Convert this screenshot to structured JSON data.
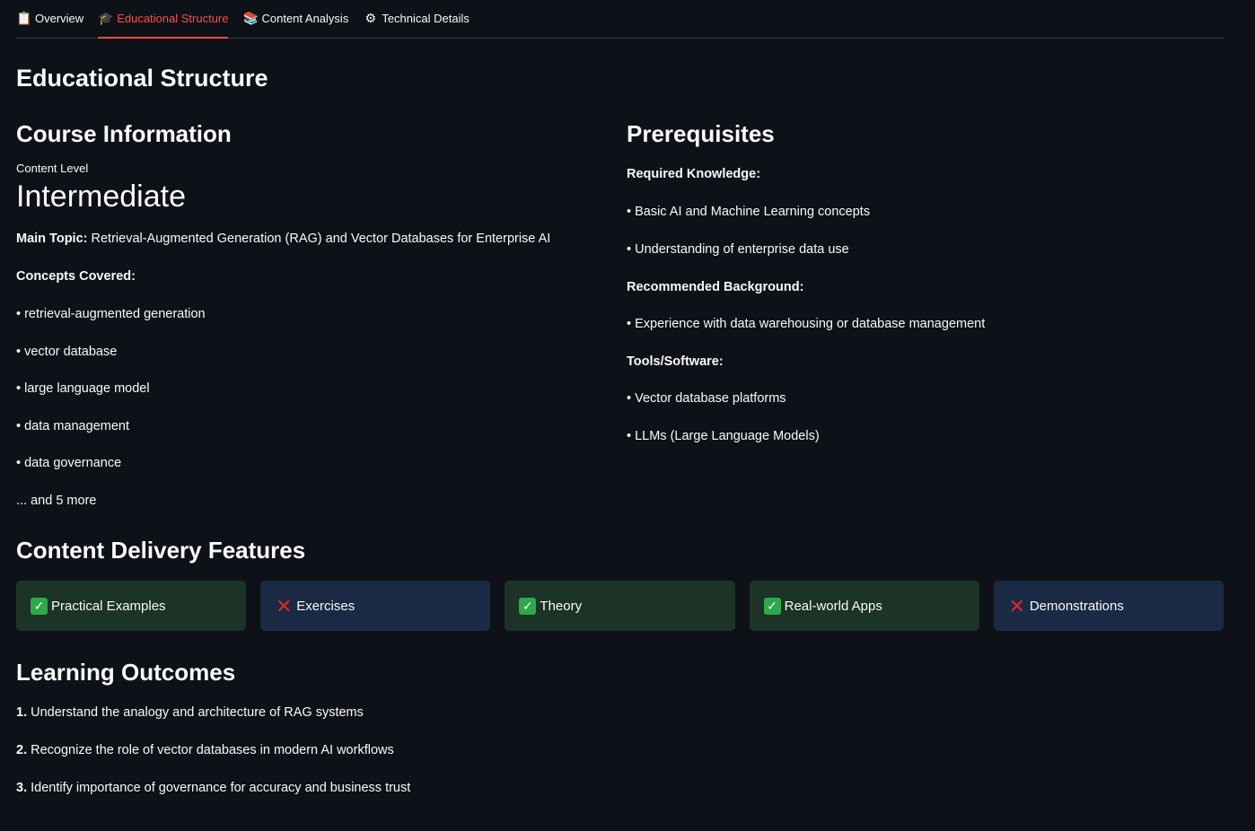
{
  "tabs": [
    {
      "icon": "📋",
      "label": "Overview",
      "active": false
    },
    {
      "icon": "🎓",
      "label": "Educational Structure",
      "active": true
    },
    {
      "icon": "📚",
      "label": "Content Analysis",
      "active": false
    },
    {
      "icon": "⚙",
      "label": "Technical Details",
      "active": false
    }
  ],
  "page_title": "Educational Structure",
  "course": {
    "heading": "Course Information",
    "metric_label": "Content Level",
    "metric_value": "Intermediate",
    "main_topic_label": "Main Topic:",
    "main_topic_value": "Retrieval-Augmented Generation (RAG) and Vector Databases for Enterprise AI",
    "concepts_label": "Concepts Covered:",
    "concepts": [
      "• retrieval-augmented generation",
      "• vector database",
      "• large language model",
      "• data management",
      "• data governance"
    ],
    "more": "... and 5 more"
  },
  "prereq": {
    "heading": "Prerequisites",
    "required_label": "Required Knowledge:",
    "required": [
      "• Basic AI and Machine Learning concepts",
      "• Understanding of enterprise data use"
    ],
    "recommended_label": "Recommended Background:",
    "recommended": [
      "• Experience with data warehousing or database management"
    ],
    "tools_label": "Tools/Software:",
    "tools": [
      "• Vector database platforms",
      "• LLMs (Large Language Models)"
    ]
  },
  "features": {
    "heading": "Content Delivery Features",
    "items": [
      {
        "label": "Practical Examples",
        "enabled": true
      },
      {
        "label": "Exercises",
        "enabled": false
      },
      {
        "label": "Theory",
        "enabled": true
      },
      {
        "label": "Real-world Apps",
        "enabled": true
      },
      {
        "label": "Demonstrations",
        "enabled": false
      }
    ],
    "colors": {
      "enabled_bg": "#1c3327",
      "disabled_bg": "#1a2a44",
      "check": "#2fa84a",
      "cross": "#e0262b"
    }
  },
  "outcomes": {
    "heading": "Learning Outcomes",
    "items": [
      {
        "num": "1.",
        "text": "Understand the analogy and architecture of RAG systems"
      },
      {
        "num": "2.",
        "text": "Recognize the role of vector databases in modern AI workflows"
      },
      {
        "num": "3.",
        "text": "Identify importance of governance for accuracy and business trust"
      }
    ]
  },
  "accent": "#ff4b4b"
}
